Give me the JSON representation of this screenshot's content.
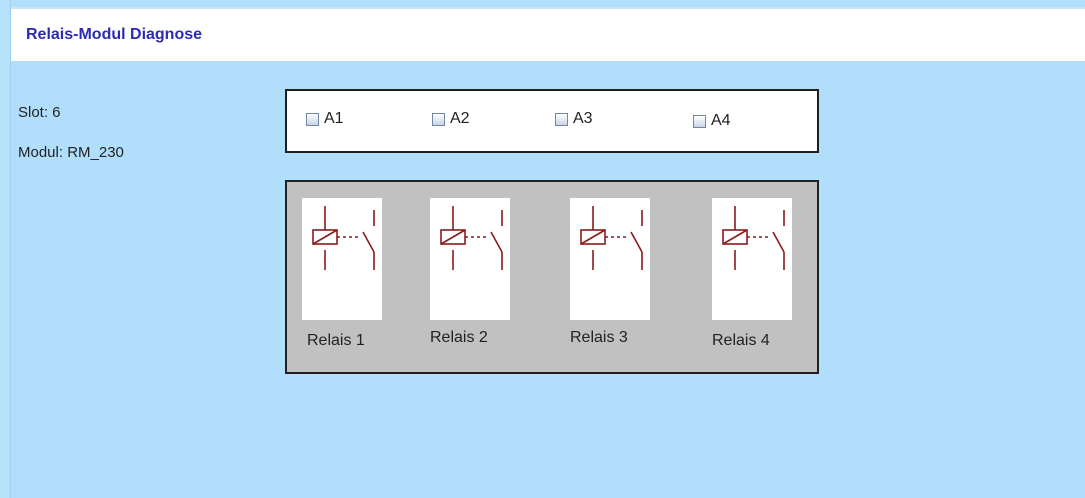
{
  "header": {
    "title": "Relais-Modul Diagnose"
  },
  "info": {
    "slot": "Slot: 6",
    "modul": "Modul: RM_230"
  },
  "outputs": [
    {
      "label": "A1",
      "checked": false
    },
    {
      "label": "A2",
      "checked": false
    },
    {
      "label": "A3",
      "checked": false
    },
    {
      "label": "A4",
      "checked": false
    }
  ],
  "relays": [
    {
      "label": "Relais 1",
      "icon": "relay-symbol-icon"
    },
    {
      "label": "Relais 2",
      "icon": "relay-symbol-icon"
    },
    {
      "label": "Relais 3",
      "icon": "relay-symbol-icon"
    },
    {
      "label": "Relais 4",
      "icon": "relay-symbol-icon"
    }
  ],
  "colors": {
    "background": "#b1dffb",
    "title": "#2b2bb5",
    "relay_symbol": "#8b1a1a",
    "panel_gray": "#c1c1c1"
  }
}
